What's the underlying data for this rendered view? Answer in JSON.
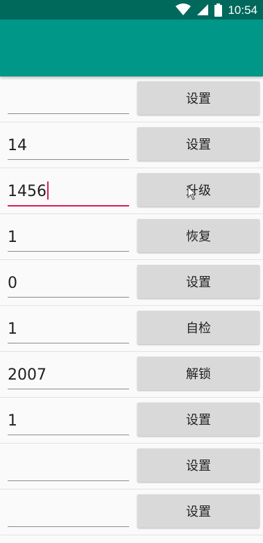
{
  "status_bar": {
    "time": "10:54",
    "icons": [
      "wifi-icon",
      "signal-icon",
      "battery-icon"
    ]
  },
  "app_bar": {
    "title": ""
  },
  "rows": [
    {
      "value": "",
      "button": "设置"
    },
    {
      "value": "14",
      "button": "设置"
    },
    {
      "value": "1456",
      "button": "升级",
      "focused": true
    },
    {
      "value": "1",
      "button": "恢复"
    },
    {
      "value": "0",
      "button": "设置"
    },
    {
      "value": "1",
      "button": "自检"
    },
    {
      "value": "2007",
      "button": "解锁"
    },
    {
      "value": "1",
      "button": "设置"
    },
    {
      "value": "",
      "button": "设置"
    },
    {
      "value": "",
      "button": "设置"
    }
  ],
  "colors": {
    "status_bar": "#00695c",
    "app_bar": "#009688",
    "accent": "#d81b60",
    "button_bg": "#d9d9d9"
  }
}
